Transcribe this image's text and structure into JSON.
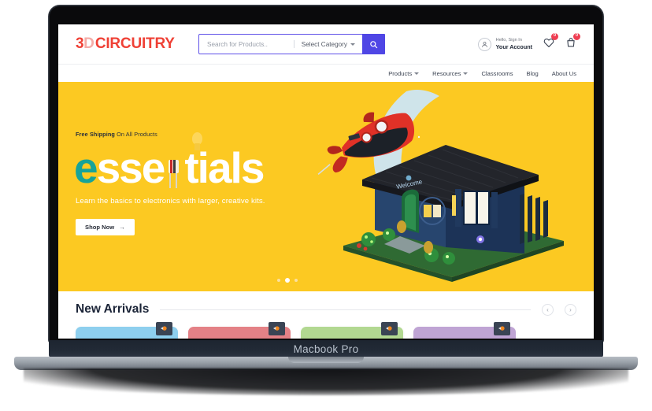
{
  "mockup": {
    "device_label": "Macbook Pro"
  },
  "header": {
    "logo": {
      "part1": "3",
      "part2": "D",
      "part3": "CIRCUITRY",
      "color": "#ef4136"
    },
    "search": {
      "placeholder": "Search for Products..",
      "value": "",
      "category_label": "Select Category",
      "search_icon": "search-icon",
      "button_color": "#4f46e5"
    },
    "account": {
      "icon": "user-icon",
      "greeting": "Hello, Sign In",
      "name": "Your Account"
    },
    "wishlist": {
      "icon": "heart-icon",
      "count": "0"
    },
    "cart": {
      "icon": "bag-icon",
      "count": "0"
    },
    "badge_color": "#ef3e52"
  },
  "nav": {
    "items": [
      {
        "label": "Products",
        "has_dropdown": true
      },
      {
        "label": "Resources",
        "has_dropdown": true
      },
      {
        "label": "Classrooms",
        "has_dropdown": false
      },
      {
        "label": "Blog",
        "has_dropdown": false
      },
      {
        "label": "About Us",
        "has_dropdown": false
      }
    ]
  },
  "hero": {
    "background_color": "#fcc922",
    "eyebrow_bold": "Free Shipping",
    "eyebrow_rest": " On All Products",
    "wordmark": {
      "letter_e": "e",
      "letters_sse": "sse",
      "resistor_glyph": "resistor-n",
      "letters_tials": "tials",
      "e_color": "#17a398"
    },
    "tagline": "Learn the basics to electronics with larger, creative kits.",
    "cta_label": "Shop Now",
    "cta_arrow": "→",
    "illustration": {
      "rocket": "red-rocket",
      "moon": "crescent-moon",
      "house": "model-house-kit",
      "house_sign": "Welcome"
    },
    "dots": {
      "count": 3,
      "active_index": 1
    }
  },
  "new_arrivals": {
    "title": "New Arrivals",
    "prev_arrow": "‹",
    "next_arrow": "›",
    "cards": [
      {
        "color": "#8ecfee"
      },
      {
        "color": "#e48186"
      },
      {
        "color": "#b2d891"
      },
      {
        "color": "#bfa4d4"
      }
    ]
  }
}
